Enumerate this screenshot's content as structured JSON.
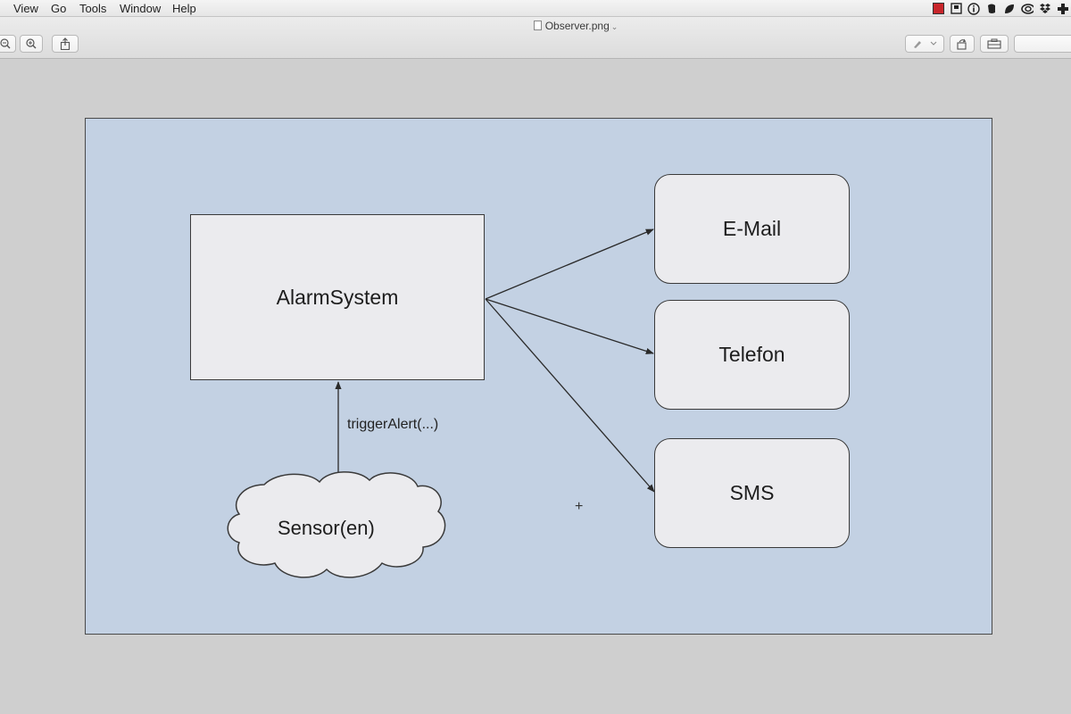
{
  "menubar": {
    "items": [
      "View",
      "Go",
      "Tools",
      "Window",
      "Help"
    ]
  },
  "window": {
    "title": "Observer.png"
  },
  "toolbar": {
    "left_buttons": [
      "zoom-out-icon",
      "zoom-in-icon",
      "share-icon"
    ],
    "right_buttons": [
      "markup-icon",
      "rotate-icon",
      "toolbox-icon",
      "search-field"
    ]
  },
  "diagram": {
    "subject": "AlarmSystem",
    "observers": [
      "E-Mail",
      "Telefon",
      "SMS"
    ],
    "source": "Sensor(en)",
    "edge_label": "triggerAlert(...)",
    "colors": {
      "canvas": "#c3d1e3",
      "node_fill": "#ebebee",
      "stroke": "#3a3a3a"
    }
  }
}
